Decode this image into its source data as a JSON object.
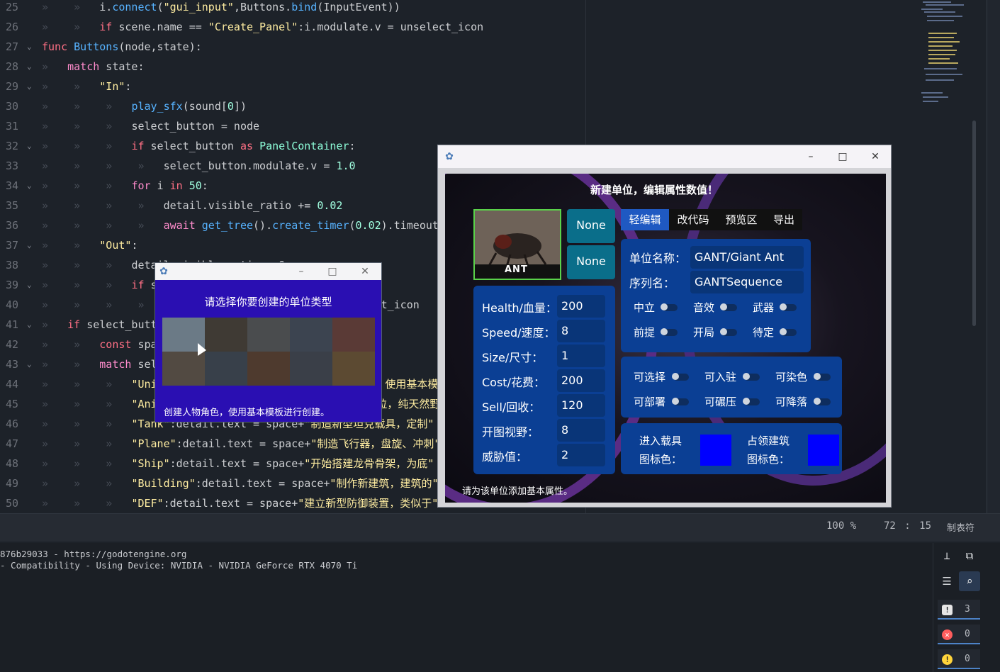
{
  "editor": {
    "lines": [
      {
        "n": "25",
        "html": "<span class='tabs'>»    »   </span>i.<span class='fn'>connect</span>(<span class='str'>\"gui_input\"</span>,Buttons.<span class='fn'>bind</span>(InputEvent))",
        "fold": false
      },
      {
        "n": "26",
        "html": "<span class='tabs'>»    »   </span><span class='kw'>if</span> scene.name == <span class='str'>\"Create_Panel\"</span>:i.modulate.v = unselect_icon",
        "fold": false
      },
      {
        "n": "27",
        "html": "<span class='kw'>func</span> <span class='fn'>Buttons</span>(node,state):",
        "fold": true
      },
      {
        "n": "28",
        "html": "<span class='tabs'>»   </span><span class='ctl'>match</span> state:",
        "fold": true
      },
      {
        "n": "29",
        "html": "<span class='tabs'>»    »   </span><span class='str'>\"In\"</span>:",
        "fold": true
      },
      {
        "n": "30",
        "html": "<span class='tabs'>»    »    »   </span><span class='fn'>play_sfx</span>(sound[<span class='num'>0</span>])",
        "fold": false
      },
      {
        "n": "31",
        "html": "<span class='tabs'>»    »    »   </span>select_button = node",
        "fold": false
      },
      {
        "n": "32",
        "html": "<span class='tabs'>»    »    »   </span><span class='kw'>if</span> select_button <span class='kw'>as</span> <span class='cls'>PanelContainer</span>:",
        "fold": true
      },
      {
        "n": "33",
        "html": "<span class='tabs'>»    »    »    »   </span>select_button.modulate.v = <span class='num'>1.0</span>",
        "fold": false
      },
      {
        "n": "34",
        "html": "<span class='tabs'>»    »    »   </span><span class='ctl'>for</span> i <span class='kw'>in</span> <span class='num'>50</span>:",
        "fold": true
      },
      {
        "n": "35",
        "html": "<span class='tabs'>»    »    »    »   </span>detail.visible_ratio += <span class='num'>0.02</span>",
        "fold": false
      },
      {
        "n": "36",
        "html": "<span class='tabs'>»    »    »    »   </span><span class='ctl'>await</span> <span class='fn'>get_tree</span>().<span class='fn'>create_timer</span>(<span class='num'>0.02</span>).timeout",
        "fold": false
      },
      {
        "n": "37",
        "html": "<span class='tabs'>»    »   </span><span class='str'>\"Out\"</span>:",
        "fold": true
      },
      {
        "n": "38",
        "html": "<span class='tabs'>»    »    »   </span>detail.visible_ratio = 0",
        "fold": false
      },
      {
        "n": "39",
        "html": "<span class='tabs'>»    »    »   </span><span class='kw'>if</span> select_button <span class='kw'>is</span> Panel:",
        "fold": true
      },
      {
        "n": "40",
        "html": "<span class='tabs'>»    »    »    »   </span>select_button.modulate.v = unselect_icon",
        "fold": false
      },
      {
        "n": "41",
        "html": "<span class='tabs'>»   </span><span class='kw'>if</span> select_button:",
        "fold": true
      },
      {
        "n": "42",
        "html": "<span class='tabs'>»    »   </span><span class='kw'>const</span> space = <span class='str'>\"  \"</span>",
        "fold": false
      },
      {
        "n": "43",
        "html": "<span class='tabs'>»    »   </span><span class='ctl'>match</span> select_button.name:",
        "fold": true
      },
      {
        "n": "44",
        "html": "<span class='tabs'>»    »    »   </span><span class='str'>\"Unit\"</span>:detail.text = space+<span class='str'>\"创建人物角色，使用基本模板进行创建。\"</span>",
        "fold": false
      },
      {
        "n": "45",
        "html": "<span class='tabs'>»    »    »   </span><span class='str'>\"Animal\"</span>:detail.text = space+<span class='str'>\"创建动物单位，纯天然野生\"</span>",
        "fold": false
      },
      {
        "n": "46",
        "html": "<span class='tabs'>»    »    »   </span><span class='str'>\"Tank\"</span>:detail.text = space+<span class='str'>\"制造新型坦克载具，定制\"</span>",
        "fold": false
      },
      {
        "n": "47",
        "html": "<span class='tabs'>»    »    »   </span><span class='str'>\"Plane\"</span>:detail.text = space+<span class='str'>\"制造飞行器，盘旋、冲刺\"</span>",
        "fold": false
      },
      {
        "n": "48",
        "html": "<span class='tabs'>»    »    »   </span><span class='str'>\"Ship\"</span>:detail.text = space+<span class='str'>\"开始搭建龙骨骨架，为底\"</span>",
        "fold": false
      },
      {
        "n": "49",
        "html": "<span class='tabs'>»    »    »   </span><span class='str'>\"Building\"</span>:detail.text = space+<span class='str'>\"制作新建筑，建筑的\"</span>",
        "fold": false
      },
      {
        "n": "50",
        "html": "<span class='tabs'>»    »    »   </span><span class='str'>\"DEF\"</span>:detail.text = space+<span class='str'>\"建立新型防御装置，类似于\"</span>",
        "fold": false
      }
    ]
  },
  "status": {
    "zoom": "100 %",
    "line": "72",
    "sep": ":",
    "col": "15",
    "indent": "制表符"
  },
  "output": {
    "line1": "876b29033 - https://godotengine.org",
    "line2": "- Compatibility - Using Device: NVIDIA - NVIDIA GeForce RTX 4070 Ti"
  },
  "filters": {
    "errors_icon": "!",
    "errors": "3",
    "warnings": "0",
    "info": "0"
  },
  "window1": {
    "title": "请选择你要创建的单位类型",
    "description": "创建人物角色，使用基本模板进行创建。"
  },
  "window2": {
    "heading": "新建单位，编辑属性数值！",
    "portrait_label": "ANT",
    "none1": "None",
    "none2": "None",
    "tabs": [
      "轻编辑",
      "改代码",
      "预览区",
      "导出"
    ],
    "name_label": "单位名称：",
    "name_value": "GANT/Giant Ant",
    "seq_label": "序列名：",
    "seq_value": "GANTSequence",
    "stats": [
      {
        "label": "Health/血量：",
        "value": "200"
      },
      {
        "label": "Speed/速度：",
        "value": "8"
      },
      {
        "label": "Size/尺寸：",
        "value": "1"
      },
      {
        "label": "Cost/花费：",
        "value": "200"
      },
      {
        "label": "Sell/回收：",
        "value": "120"
      },
      {
        "label": "开图视野：",
        "value": "8"
      },
      {
        "label": "威胁值：",
        "value": "2"
      }
    ],
    "flags1": [
      "中立",
      "音效",
      "武器",
      "前提",
      "开局",
      "待定"
    ],
    "flags2": [
      "可选择",
      "可入驻",
      "可染色",
      "可部署",
      "可碾压",
      "可降落"
    ],
    "vehicle_color_label_1": "进入载具",
    "vehicle_color_label_2": "图标色：",
    "building_color_label_1": "占领建筑",
    "building_color_label_2": "图标色：",
    "vehicle_color": "#0000ff",
    "building_color": "#0000ff",
    "footer": "请为该单位添加基本属性。"
  }
}
